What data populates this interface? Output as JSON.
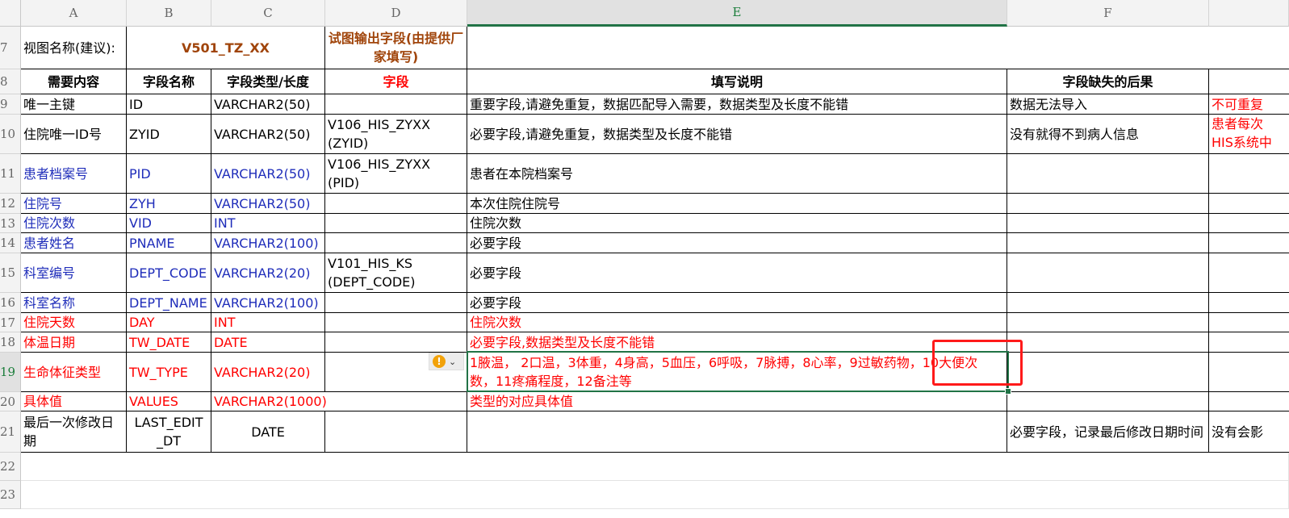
{
  "columns": [
    "A",
    "B",
    "C",
    "D",
    "E",
    "F",
    ""
  ],
  "rows": [
    "7",
    "8",
    "9",
    "10",
    "11",
    "12",
    "13",
    "14",
    "15",
    "16",
    "17",
    "18",
    "19",
    "20",
    "21",
    "22",
    "23"
  ],
  "r7": {
    "a": "视图名称(建议):",
    "bc": "V501_TZ_XX",
    "d": "试图输出字段(由提供厂家填写)"
  },
  "r8": {
    "a": "需要内容",
    "b": "字段名称",
    "c": "字段类型/长度",
    "d": "字段",
    "e": "填写说明",
    "f": "字段缺失的后果"
  },
  "r9": {
    "a": "唯一主键",
    "b": "ID",
    "c": "VARCHAR2(50)",
    "d": "",
    "e": "重要字段,请避免重复，数据匹配导入需要，数据类型及长度不能错",
    "f": "数据无法导入",
    "g": "不可重复"
  },
  "r10": {
    "a": "住院唯一ID号",
    "b": "ZYID",
    "c": "VARCHAR2(50)",
    "d": "V106_HIS_ZYXX (ZYID)",
    "e": "必要字段,请避免重复，数据类型及长度不能错",
    "f": "没有就得不到病人信息",
    "g": "患者每次 HIS系统中"
  },
  "r11": {
    "a": "患者档案号",
    "b": "PID",
    "c": "VARCHAR2(50)",
    "d": "V106_HIS_ZYXX (PID)",
    "e": "患者在本院档案号"
  },
  "r12": {
    "a": "住院号",
    "b": "ZYH",
    "c": "VARCHAR2(50)",
    "e": "本次住院住院号"
  },
  "r13": {
    "a": "住院次数",
    "b": "VID",
    "c": "INT",
    "e": "住院次数"
  },
  "r14": {
    "a": "患者姓名",
    "b": "PNAME",
    "c": "VARCHAR2(100)",
    "e": "必要字段"
  },
  "r15": {
    "a": "科室编号",
    "b": "DEPT_CODE",
    "c": "VARCHAR2(20)",
    "d": "V101_HIS_KS (DEPT_CODE)",
    "e": "必要字段"
  },
  "r16": {
    "a": "科室名称",
    "b": "DEPT_NAME",
    "c": "VARCHAR2(100)",
    "e": "必要字段"
  },
  "r17": {
    "a": "住院天数",
    "b": "DAY",
    "c": "INT",
    "e": "住院次数"
  },
  "r18": {
    "a": "体温日期",
    "b": "TW_DATE",
    "c": "DATE",
    "e": "必要字段,数据类型及长度不能错"
  },
  "r19": {
    "a": "生命体征类型",
    "b": "TW_TYPE",
    "c": "VARCHAR2(20)",
    "e": " 1腋温， 2口温，3体重，4身高，5血压，6呼吸，7脉搏，8心率，9过敏药物，10大便次数，11疼痛程度，12备注等"
  },
  "r20": {
    "a": "具体值",
    "b": "VALUES",
    "c": "VARCHAR2(1000)",
    "e": "类型的对应具体值"
  },
  "r21": {
    "a": "最后一次修改日期",
    "b": "LAST_EDIT_DT",
    "c": "DATE",
    "f": "必要字段，记录最后修改日期时间",
    "g": "没有会影"
  },
  "icons": {
    "warning": "warning-icon",
    "dropdown": "chevron-down-icon",
    "warning_glyph": "!",
    "chevron_glyph": "⌄"
  },
  "colors": {
    "blue": "#1f2dba",
    "red": "#ff0000",
    "brown": "#a0440a",
    "selection": "#217346"
  }
}
